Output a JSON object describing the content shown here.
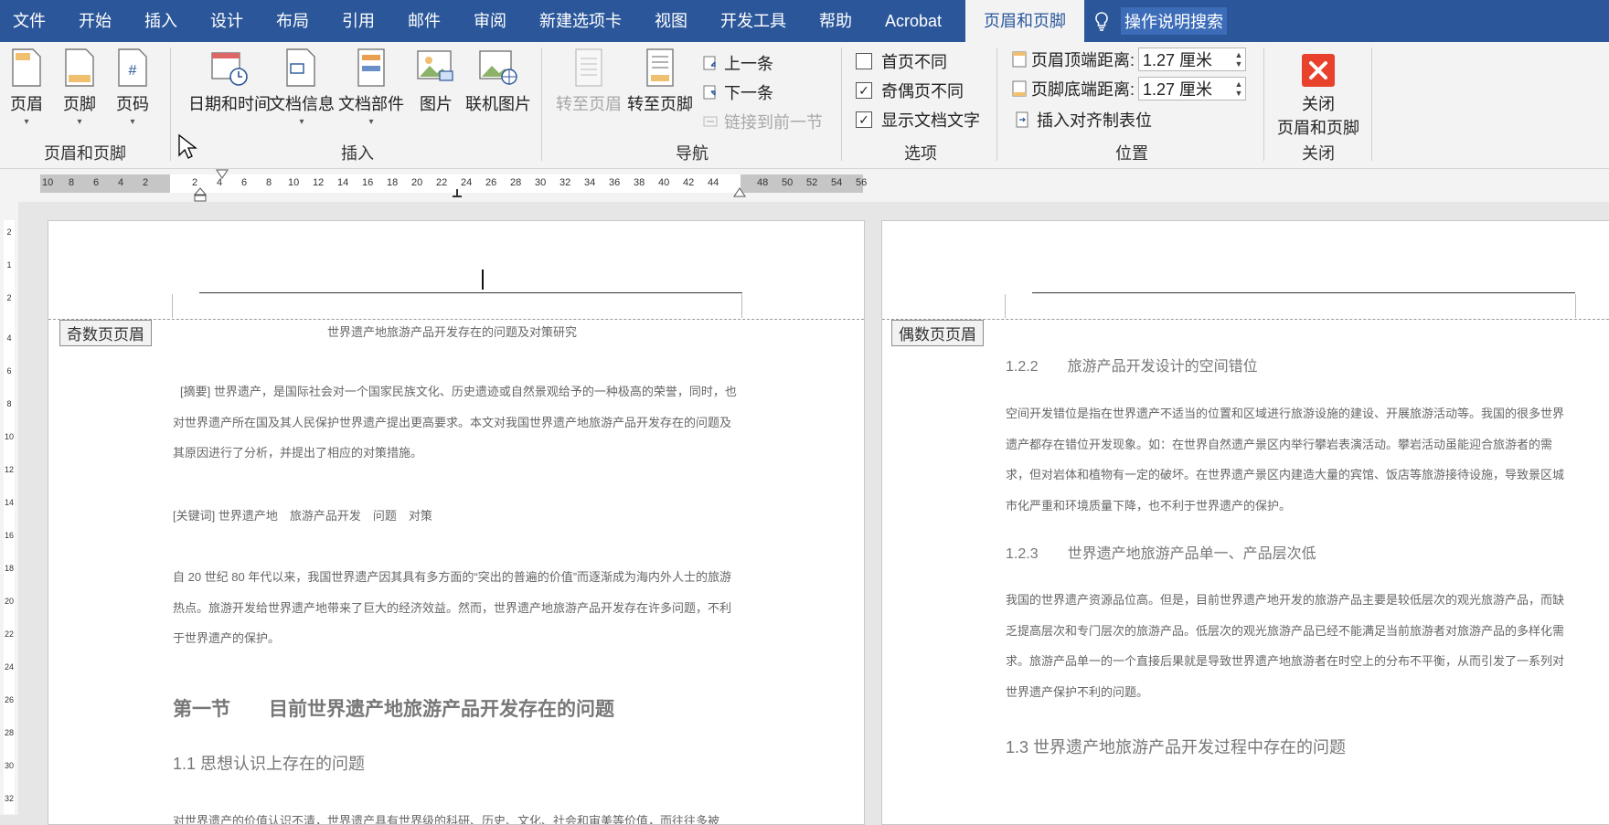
{
  "tabs": [
    "文件",
    "开始",
    "插入",
    "设计",
    "布局",
    "引用",
    "邮件",
    "审阅",
    "新建选项卡",
    "视图",
    "开发工具",
    "帮助",
    "Acrobat"
  ],
  "active_tab": "页眉和页脚",
  "tell_me": "操作说明搜索",
  "groups": {
    "header_footer": {
      "label": "页眉和页脚",
      "buttons": [
        "页眉",
        "页脚",
        "页码"
      ]
    },
    "insert": {
      "label": "插入",
      "buttons": [
        "日期和时间",
        "文档信息",
        "文档部件",
        "图片",
        "联机图片"
      ]
    },
    "navigation": {
      "label": "导航",
      "goto_header": "转至页眉",
      "goto_footer": "转至页脚",
      "previous": "上一条",
      "next": "下一条",
      "link_previous": "链接到前一节"
    },
    "options": {
      "label": "选项",
      "items": [
        {
          "label": "首页不同",
          "checked": false
        },
        {
          "label": "奇偶页不同",
          "checked": true
        },
        {
          "label": "显示文档文字",
          "checked": true
        }
      ]
    },
    "position": {
      "label": "位置",
      "header_top_label": "页眉顶端距离:",
      "header_top_value": "1.27 厘米",
      "footer_bottom_label": "页脚底端距离:",
      "footer_bottom_value": "1.27 厘米",
      "insert_align_tab": "插入对齐制表位"
    },
    "close": {
      "label": "关闭",
      "button_line1": "关闭",
      "button_line2": "页眉和页脚"
    }
  },
  "ruler": {
    "numbers": [
      "10",
      "8",
      "6",
      "4",
      "2",
      "2",
      "4",
      "6",
      "8",
      "10",
      "12",
      "14",
      "16",
      "18",
      "20",
      "22",
      "24",
      "26",
      "28",
      "30",
      "32",
      "34",
      "36",
      "38",
      "40",
      "42",
      "44",
      "48",
      "50",
      "52",
      "54",
      "56"
    ],
    "vertical_numbers": [
      "2",
      "1",
      "2",
      "4",
      "6",
      "8",
      "10",
      "12",
      "14",
      "16",
      "18",
      "20",
      "22",
      "24",
      "26",
      "28",
      "30",
      "32"
    ]
  },
  "page_left": {
    "header_tag": "奇数页页眉",
    "running_head": "世界遗产地旅游产品开发存在的问题及对策研究",
    "abstract": "[摘要] 世界遗产，是国际社会对一个国家民族文化、历史遗迹或自然景观给予的一种极高的荣誉，同时，也对世界遗产所在国及其人民保护世界遗产提出更高要求。本文对我国世界遗产地旅游产品开发存在的问题及其原因进行了分析，并提出了相应的对策措施。",
    "keywords": "[关键词] 世界遗产地　旅游产品开发　问题　对策",
    "intro": "自 20 世纪 80 年代以来，我国世界遗产因其具有多方面的“突出的普遍的价值”而逐渐成为海内外人士的旅游热点。旅游开发给世界遗产地带来了巨大的经济效益。然而，世界遗产地旅游产品开发存在许多问题，不利于世界遗产的保护。",
    "section_title": "第一节　　目前世界遗产地旅游产品开发存在的问题",
    "sub_title": "1.1  思想认识上存在的问题",
    "partial_line": "对世界遗产的价值认识不清，世界遗产具有世界级的科研、历史、文化、社会和审美等价值，而往往多被"
  },
  "page_right": {
    "header_tag": "偶数页页眉",
    "h_122": "1.2.2　　旅游产品开发设计的空间错位",
    "p_122": "空间开发错位是指在世界遗产不适当的位置和区域进行旅游设施的建设、开展旅游活动等。我国的很多世界遗产都存在错位开发现象。如：在世界自然遗产景区内举行攀岩表演活动。攀岩活动虽能迎合旅游者的需求，但对岩体和植物有一定的破坏。在世界遗产景区内建造大量的宾馆、饭店等旅游接待设施，导致景区城市化严重和环境质量下降，也不利于世界遗产的保护。",
    "h_123": "1.2.3　　世界遗产地旅游产品单一、产品层次低",
    "p_123": "我国的世界遗产资源品位高。但是，目前世界遗产地开发的旅游产品主要是较低层次的观光旅游产品，而缺乏提高层次和专门层次的旅游产品。低层次的观光旅游产品已经不能满足当前旅游者对旅游产品的多样化需求。旅游产品单一的一个直接后果就是导致世界遗产地旅游者在时空上的分布不平衡，从而引发了一系列对世界遗产保护不利的问题。",
    "h_13": "1.3  世界遗产地旅游产品开发过程中存在的问题"
  },
  "colors": {
    "tabbar": "#2b579a",
    "ribbon": "#f3f3f3",
    "close_red": "#e8412c"
  },
  "icons": [
    "header-icon",
    "footer-icon",
    "page-number-icon",
    "date-time-icon",
    "doc-info-icon",
    "quick-parts-icon",
    "picture-icon",
    "online-picture-icon",
    "goto-header-icon",
    "goto-footer-icon",
    "previous-icon",
    "next-icon",
    "link-icon",
    "close-x-icon",
    "lightbulb-icon"
  ]
}
